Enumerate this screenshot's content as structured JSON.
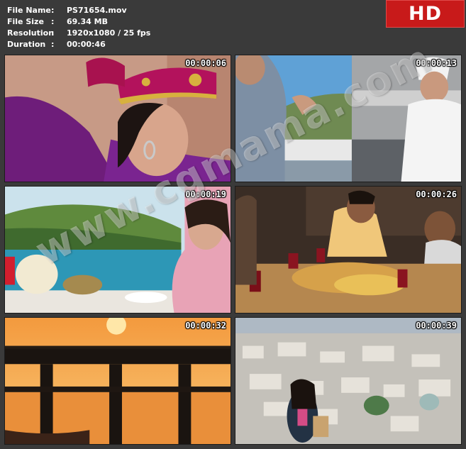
{
  "meta": {
    "rows": [
      {
        "key": "File Name",
        "value": "PS71654.mov"
      },
      {
        "key": "File Size",
        "value": "69.34 MB"
      },
      {
        "key": "Resolution",
        "value": "1920x1080 / 25 fps"
      },
      {
        "key": "Duration",
        "value": "00:00:46"
      }
    ],
    "colon": ":"
  },
  "badge": "HD",
  "thumbnails": [
    {
      "timestamp": "00:00:06",
      "scene": "dancer-purple-costume"
    },
    {
      "timestamp": "00:00:13",
      "scene": "harbor-and-chef"
    },
    {
      "timestamp": "00:00:19",
      "scene": "seaside-dining"
    },
    {
      "timestamp": "00:00:26",
      "scene": "dinner-table"
    },
    {
      "timestamp": "00:00:32",
      "scene": "sunset-pier"
    },
    {
      "timestamp": "00:00:39",
      "scene": "city-view-woman"
    }
  ],
  "watermark": "www.cgmama.com",
  "colors": {
    "background": "#3a3a3a",
    "badge": "#c81a1a"
  }
}
